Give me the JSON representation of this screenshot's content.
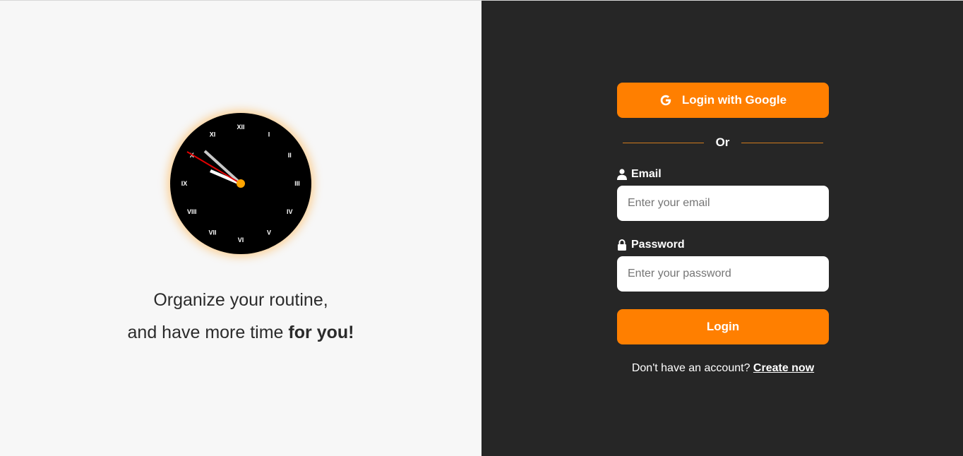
{
  "left": {
    "clock": {
      "numerals": [
        "XII",
        "I",
        "II",
        "III",
        "IV",
        "V",
        "VI",
        "VII",
        "VIII",
        "IX",
        "X",
        "XI"
      ],
      "face_color": "#000000",
      "center_color": "#ffa500",
      "second_hand_color": "#e00000"
    },
    "tagline": {
      "line1": "Organize your routine,",
      "line2_prefix": "and have more time ",
      "line2_bold": "for you!"
    }
  },
  "right": {
    "google_button": {
      "label": "Login with Google",
      "icon": "google-g-icon"
    },
    "divider_text": "Or",
    "email": {
      "label": "Email",
      "icon": "user-icon",
      "placeholder": "Enter your email",
      "value": ""
    },
    "password": {
      "label": "Password",
      "icon": "lock-icon",
      "placeholder": "Enter your password",
      "value": ""
    },
    "login_button": {
      "label": "Login"
    },
    "signup": {
      "prompt": "Don't have an account? ",
      "link": "Create now"
    }
  },
  "colors": {
    "accent": "#ff7f00",
    "dark_panel": "#262626",
    "light_panel": "#f7f7f7"
  }
}
